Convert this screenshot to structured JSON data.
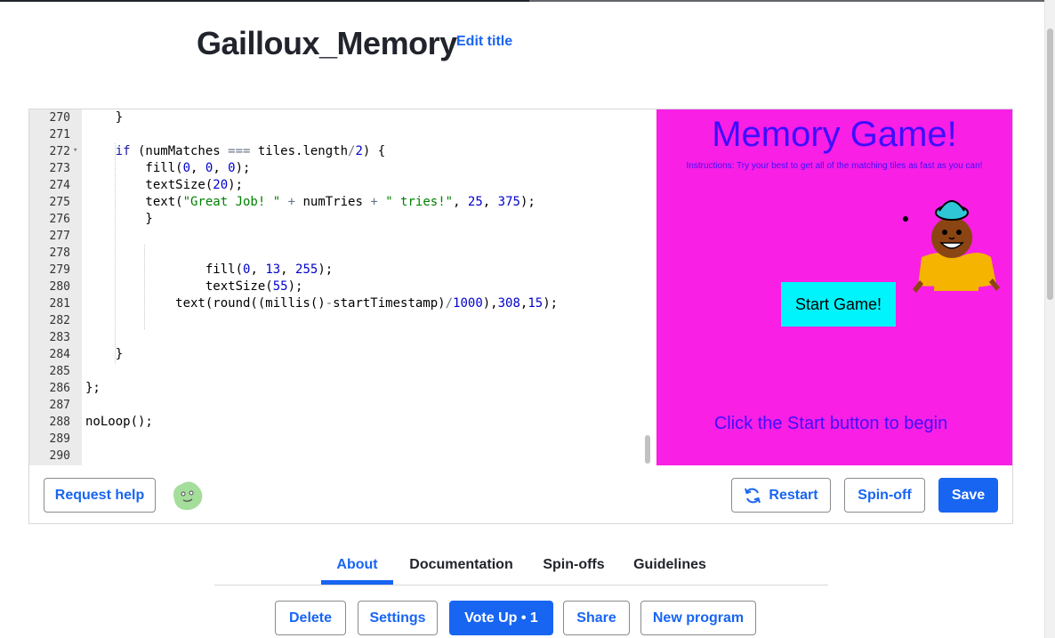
{
  "program": {
    "title": "Gailloux_Memory",
    "edit_title_label": "Edit title"
  },
  "code_lines": [
    {
      "n": "270",
      "text": "    }"
    },
    {
      "n": "271",
      "text": ""
    },
    {
      "n": "272",
      "text": "    if (numMatches === tiles.length/2) {",
      "fold": true
    },
    {
      "n": "273",
      "text": "        fill(0, 0, 0);"
    },
    {
      "n": "274",
      "text": "        textSize(20);"
    },
    {
      "n": "275",
      "text": "        text(\"Great Job! \" + numTries + \" tries!\", 25, 375);"
    },
    {
      "n": "276",
      "text": "        }"
    },
    {
      "n": "277",
      "text": ""
    },
    {
      "n": "278",
      "text": ""
    },
    {
      "n": "279",
      "text": "                fill(0, 13, 255);"
    },
    {
      "n": "280",
      "text": "                textSize(55);"
    },
    {
      "n": "281",
      "text": "            text(round((millis()-startTimestamp)/1000),308,15);"
    },
    {
      "n": "282",
      "text": ""
    },
    {
      "n": "283",
      "text": ""
    },
    {
      "n": "284",
      "text": "    }"
    },
    {
      "n": "285",
      "text": ""
    },
    {
      "n": "286",
      "text": "};"
    },
    {
      "n": "287",
      "text": ""
    },
    {
      "n": "288",
      "text": "noLoop();"
    },
    {
      "n": "289",
      "text": ""
    },
    {
      "n": "290",
      "text": ""
    }
  ],
  "canvas": {
    "game_title": "Memory Game!",
    "instructions": "Instructions: Try your best to get all of the matching tiles as fast as you can!",
    "start_button": "Start Game!",
    "start_hint": "Click the Start button to begin",
    "background_color": "#f91fe5",
    "text_color": "#3f0dfd"
  },
  "toolbar": {
    "request_help": "Request help",
    "restart": "Restart",
    "spinoff": "Spin-off",
    "save": "Save",
    "restart_icon": "refresh-icon",
    "avatar_icon": "green-blob-avatar"
  },
  "tabs": [
    {
      "label": "About",
      "active": true
    },
    {
      "label": "Documentation"
    },
    {
      "label": "Spin-offs"
    },
    {
      "label": "Guidelines"
    }
  ],
  "actions": {
    "delete": "Delete",
    "settings": "Settings",
    "vote_up": "Vote Up • 1",
    "share": "Share",
    "new_program": "New program"
  },
  "colors": {
    "accent": "#1865f2",
    "keyword": "#1a1aa6",
    "string": "#008000",
    "number": "#0000cd"
  }
}
